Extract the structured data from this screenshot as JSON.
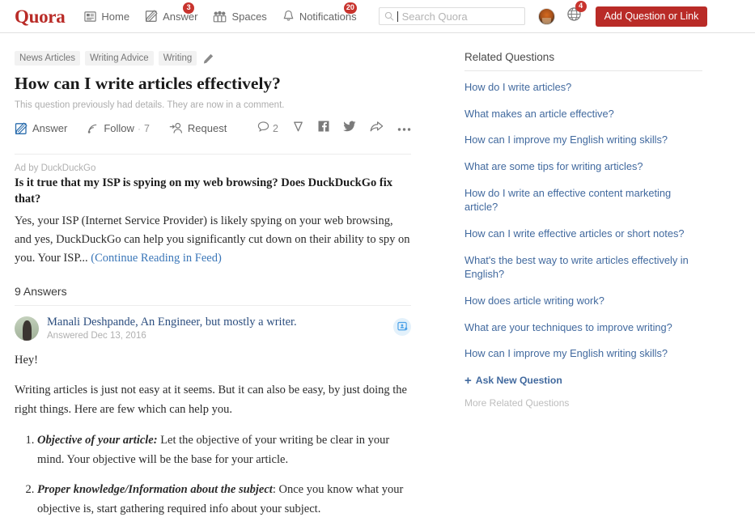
{
  "nav": {
    "logo": "Quora",
    "items": [
      {
        "label": "Home",
        "icon": "home-feed-icon",
        "badge": null
      },
      {
        "label": "Answer",
        "icon": "answer-pencil-icon",
        "badge": "3"
      },
      {
        "label": "Spaces",
        "icon": "spaces-people-icon",
        "badge": null
      },
      {
        "label": "Notifications",
        "icon": "bell-icon",
        "badge": "20"
      }
    ],
    "search_placeholder": "Search Quora",
    "search_value": "",
    "globe_badge": "4",
    "add_button": "Add Question or Link",
    "accent_red": "#b92b27"
  },
  "question": {
    "topics": [
      "News Articles",
      "Writing Advice",
      "Writing"
    ],
    "title": "How can I write articles effectively?",
    "subtitle": "This question previously had details. They are now in a comment.",
    "actions": {
      "answer": "Answer",
      "follow": "Follow",
      "follow_count": "7",
      "follow_sep": "·",
      "request": "Request",
      "comment_count": "2"
    }
  },
  "ad": {
    "label": "Ad by DuckDuckGo",
    "title": "Is it true that my ISP is spying on my web browsing? Does DuckDuckGo fix that?",
    "body": "Yes, your ISP (Internet Service Provider) is likely spying on your web browsing, and yes, DuckDuckGo can help you significantly cut down on their ability to spy on you. Your ISP... ",
    "cta": "(Continue Reading in Feed)"
  },
  "answers": {
    "count_label": "9 Answers",
    "first": {
      "author": "Manali Deshpande, An Engineer, but mostly a writer.",
      "date": "Answered Dec 13, 2016",
      "greeting": "Hey!",
      "intro": "Writing articles is just not easy at it seems. But it can also be easy, by just doing the right things. Here are few which can help you.",
      "points": [
        {
          "lead": "Objective of your article:",
          "text": " Let the objective of your writing be clear in your mind. Your objective will be the base for your article."
        },
        {
          "lead": "Proper knowledge/Information about the subject",
          "text": ": Once you know what your objective is, start gathering required info about your subject."
        }
      ]
    }
  },
  "sidebar": {
    "title": "Related Questions",
    "questions": [
      "How do I write articles?",
      "What makes an article effective?",
      "How can I improve my English writing skills?",
      "What are some tips for writing articles?",
      "How do I write an effective content marketing article?",
      "How can I write effective articles or short notes?",
      "What's the best way to write articles effectively in English?",
      "How does article writing work?",
      "What are your techniques to improve writing?",
      "How can I improve my English writing skills?"
    ],
    "ask_new": "Ask New Question",
    "ask_new_icon": "plus-icon",
    "more": "More Related Questions"
  }
}
